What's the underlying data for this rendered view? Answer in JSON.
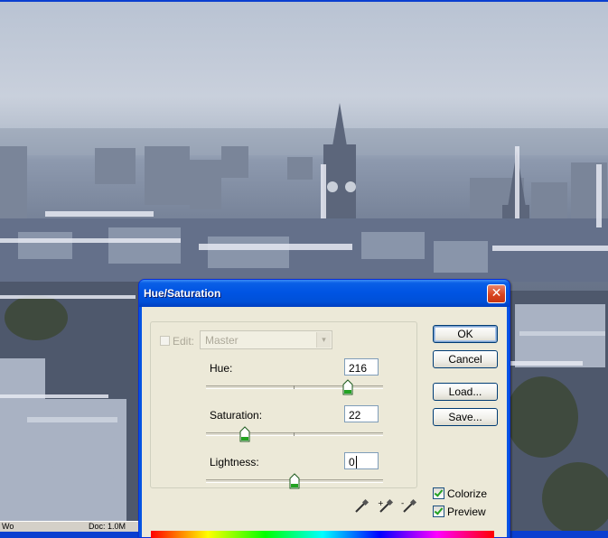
{
  "dialog": {
    "title": "Hue/Saturation",
    "close_glyph": "✕",
    "edit": {
      "label": "Edit:",
      "value": "Master",
      "arrow_glyph": "▾"
    },
    "sliders": [
      {
        "label": "Hue:",
        "value": "216",
        "level": 0.8
      },
      {
        "label": "Saturation:",
        "value": "22",
        "level": 0.22
      },
      {
        "label": "Lightness:",
        "value": "0",
        "level": 0.5
      }
    ],
    "buttons": {
      "ok": "OK",
      "cancel": "Cancel",
      "load": "Load...",
      "save": "Save..."
    },
    "checkboxes": {
      "colorize": {
        "label": "Colorize",
        "checked": true
      },
      "preview": {
        "label": "Preview",
        "checked": true
      }
    },
    "icons": [
      "eyedropper-icon",
      "eyedropper-plus-icon",
      "eyedropper-minus-icon"
    ]
  },
  "statusbar": {
    "left_text": "Wo",
    "doc_text": "Doc: 1.0M"
  },
  "colors": {
    "titlebar": "#0054e3",
    "dialog_bg": "#ece9d8",
    "close_button": "#d9441f",
    "photo_tint": "#6f7b91"
  }
}
